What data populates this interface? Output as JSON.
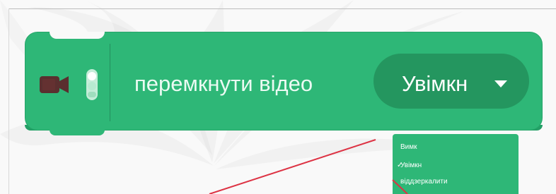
{
  "block": {
    "label": "перемкнути відео",
    "dropdown_value": "Увімкн"
  },
  "menu": {
    "items": [
      "Вимк",
      "Увімкн",
      "віддзеркалити"
    ]
  },
  "colors": {
    "block_fill": "#2eb777",
    "dropdown_fill": "#24965f",
    "menu_fill": "#2eb777",
    "red_line": "#dd3344"
  }
}
